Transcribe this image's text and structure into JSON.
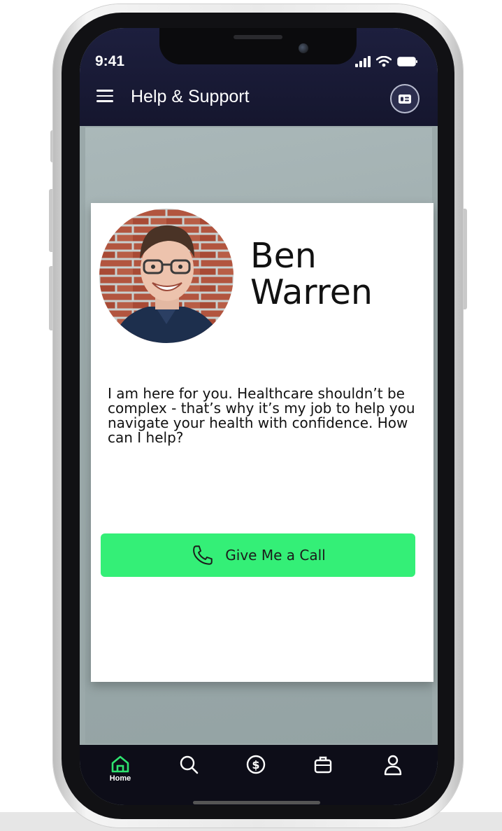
{
  "status_bar": {
    "time": "9:41"
  },
  "header": {
    "title": "Help & Support"
  },
  "profile": {
    "first_name": "Ben",
    "last_name": "Warren",
    "bio": "I am here for you. Healthcare shouldn’t be complex - that’s why it’s my job to help you navigate your health with confidence. How can I help?",
    "call_button_label": "Give Me a Call"
  },
  "tabbar": {
    "home_label": "Home",
    "items": [
      "home-icon",
      "search-icon",
      "dollar-icon",
      "briefcase-icon",
      "profile-icon"
    ],
    "active_index": 0
  },
  "colors": {
    "header_bg": "#1d1f3e",
    "accent_green": "#34ef77",
    "active_tab": "#2ee36f",
    "content_bg": "#9ba9aa"
  }
}
